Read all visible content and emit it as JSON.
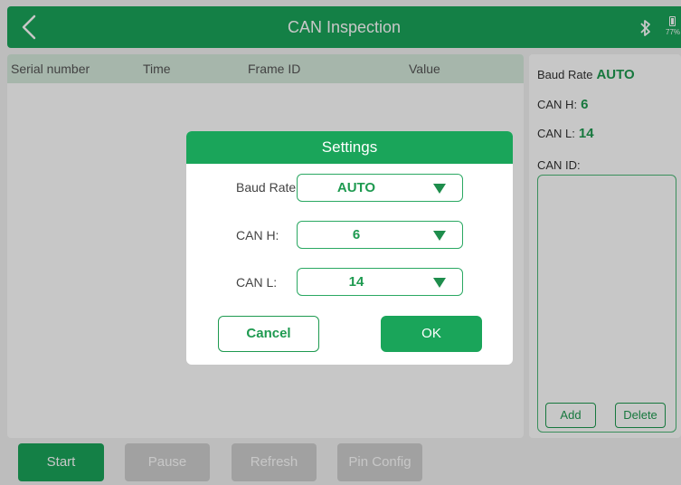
{
  "app": {
    "title": "CAN Inspection",
    "battery_percent": "77%",
    "colors": {
      "primary_green": "#1aa55a",
      "value_green": "#1e9a50",
      "disabled_gray": "#cfcfcf"
    }
  },
  "icons": [
    "back-chevron-icon",
    "bluetooth-icon",
    "battery-icon",
    "dropdown-caret-icon"
  ],
  "table": {
    "columns": [
      "Serial number",
      "Time",
      "Frame ID",
      "Value"
    ]
  },
  "side": {
    "baud_label": "Baud Rate",
    "baud_value": "AUTO",
    "canh_label": "CAN H:",
    "canh_value": "6",
    "canl_label": "CAN L:",
    "canl_value": "14",
    "canid_label": "CAN ID:",
    "add_label": "Add",
    "delete_label": "Delete"
  },
  "toolbar": {
    "start": "Start",
    "pause": "Pause",
    "refresh": "Refresh",
    "pin_config": "Pin Config"
  },
  "dialog": {
    "title": "Settings",
    "fields": [
      {
        "label": "Baud Rate",
        "value": "AUTO"
      },
      {
        "label": "CAN H:",
        "value": "6"
      },
      {
        "label": "CAN L:",
        "value": "14"
      }
    ],
    "cancel": "Cancel",
    "ok": "OK"
  }
}
